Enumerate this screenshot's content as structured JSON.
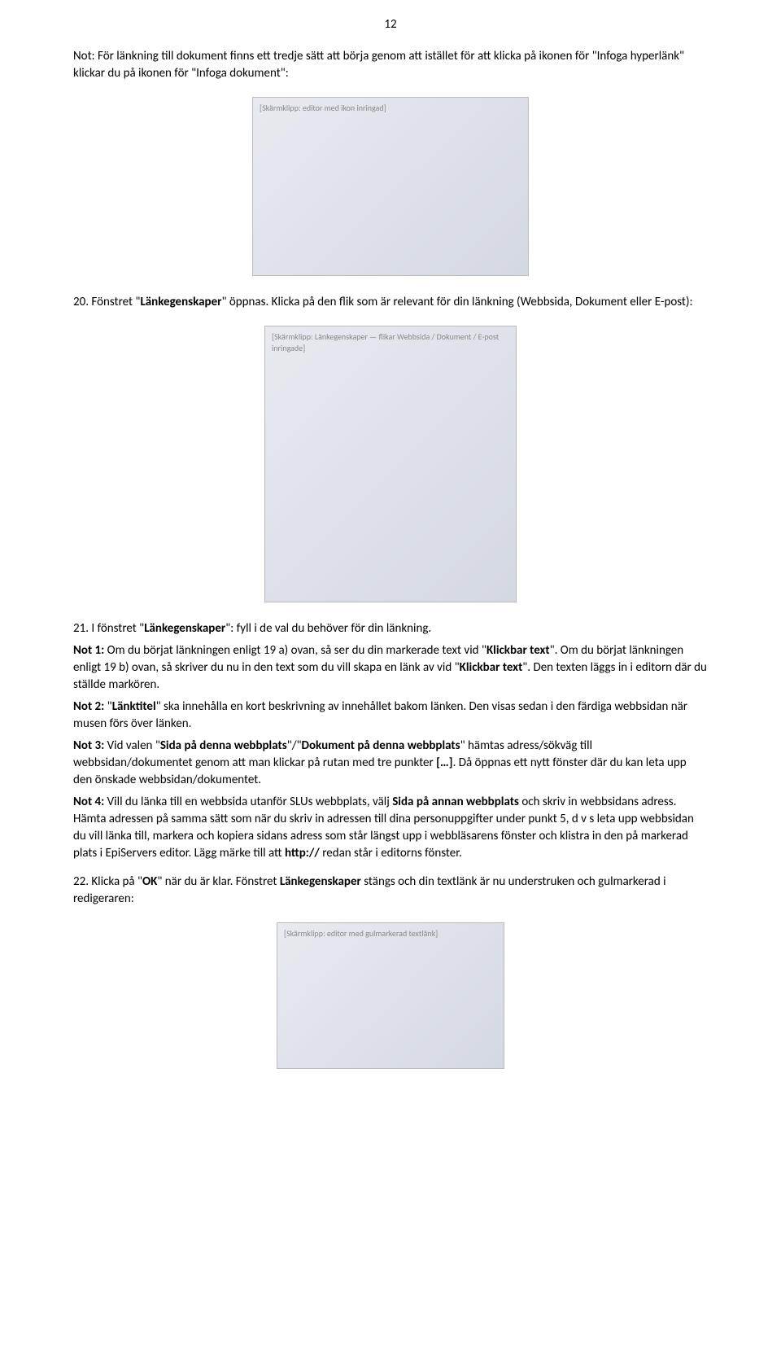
{
  "page_number": "12",
  "intro_note": "Not: För länkning till dokument finns ett tredje sätt att börja genom att istället för att klicka på ikonen för \"Infoga hyperlänk\" klickar du på ikonen för \"Infoga dokument\":",
  "screenshot1_label": "[Skärmklipp: editor med ikon inringad]",
  "step20_a": "20. Fönstret \"",
  "step20_b": "Länkegenskaper",
  "step20_c": "\" öppnas. Klicka på den flik som är relevant för din länkning (Webbsida, Dokument eller E-post):",
  "screenshot2_label": "[Skärmklipp: Länkegenskaper — flikar Webbsida / Dokument / E-post inringade]",
  "step21_a": "21. I fönstret \"",
  "step21_b": "Länkegenskaper",
  "step21_c": "\": fyll i de val du behöver för din länkning.",
  "not1_label": "Not 1:",
  "not1_a": " Om du börjat länkningen enligt 19 a) ovan, så ser du din markerade text vid \"",
  "not1_b": "Klickbar text",
  "not1_c": "\". Om du börjat länkningen enligt 19 b) ovan, så skriver du nu in den text som du vill skapa en länk av vid \"",
  "not1_d": "Klickbar text",
  "not1_e": "\". Den texten läggs in i editorn där du ställde markören.",
  "not2_label": "Not 2:",
  "not2_a": " \"",
  "not2_b": "Länktitel",
  "not2_c": "\" ska innehålla en kort beskrivning av innehållet bakom länken. Den visas sedan i den färdiga webbsidan när musen förs över länken.",
  "not3_label": "Not 3:",
  "not3_a": " Vid valen \"",
  "not3_b": "Sida på denna webbplats",
  "not3_c": "\"/\"",
  "not3_d": "Dokument på denna webbplats",
  "not3_e": "\" hämtas adress/sökväg till webbsidan/dokumentet genom att man klickar på rutan med tre punkter ",
  "not3_f": "[…]",
  "not3_g": ". Då öppnas ett nytt fönster där du kan leta upp den önskade webbsidan/dokumentet.",
  "not4_label": "Not 4:",
  "not4_a": " Vill du länka till en webbsida utanför SLUs webbplats, välj ",
  "not4_b": "Sida på annan webbplats",
  "not4_c": " och skriv in webbsidans adress. Hämta adressen på samma sätt som när du skriv in adressen till dina personuppgifter under punkt 5, d v s leta upp webbsidan du vill länka till, markera och kopiera sidans adress som står längst upp i webbläsarens fönster och klistra in den på markerad plats i EpiServers editor. Lägg märke till att ",
  "not4_d": "http://",
  "not4_e": " redan står i editorns fönster.",
  "step22_a": "22. Klicka på \"",
  "step22_b": "OK",
  "step22_c": "\" när du är klar. Fönstret ",
  "step22_d": "Länkegenskaper",
  "step22_e": " stängs och din textlänk är nu understruken och gulmarkerad i redigeraren:",
  "screenshot3_label": "[Skärmklipp: editor med gulmarkerad textlänk]"
}
